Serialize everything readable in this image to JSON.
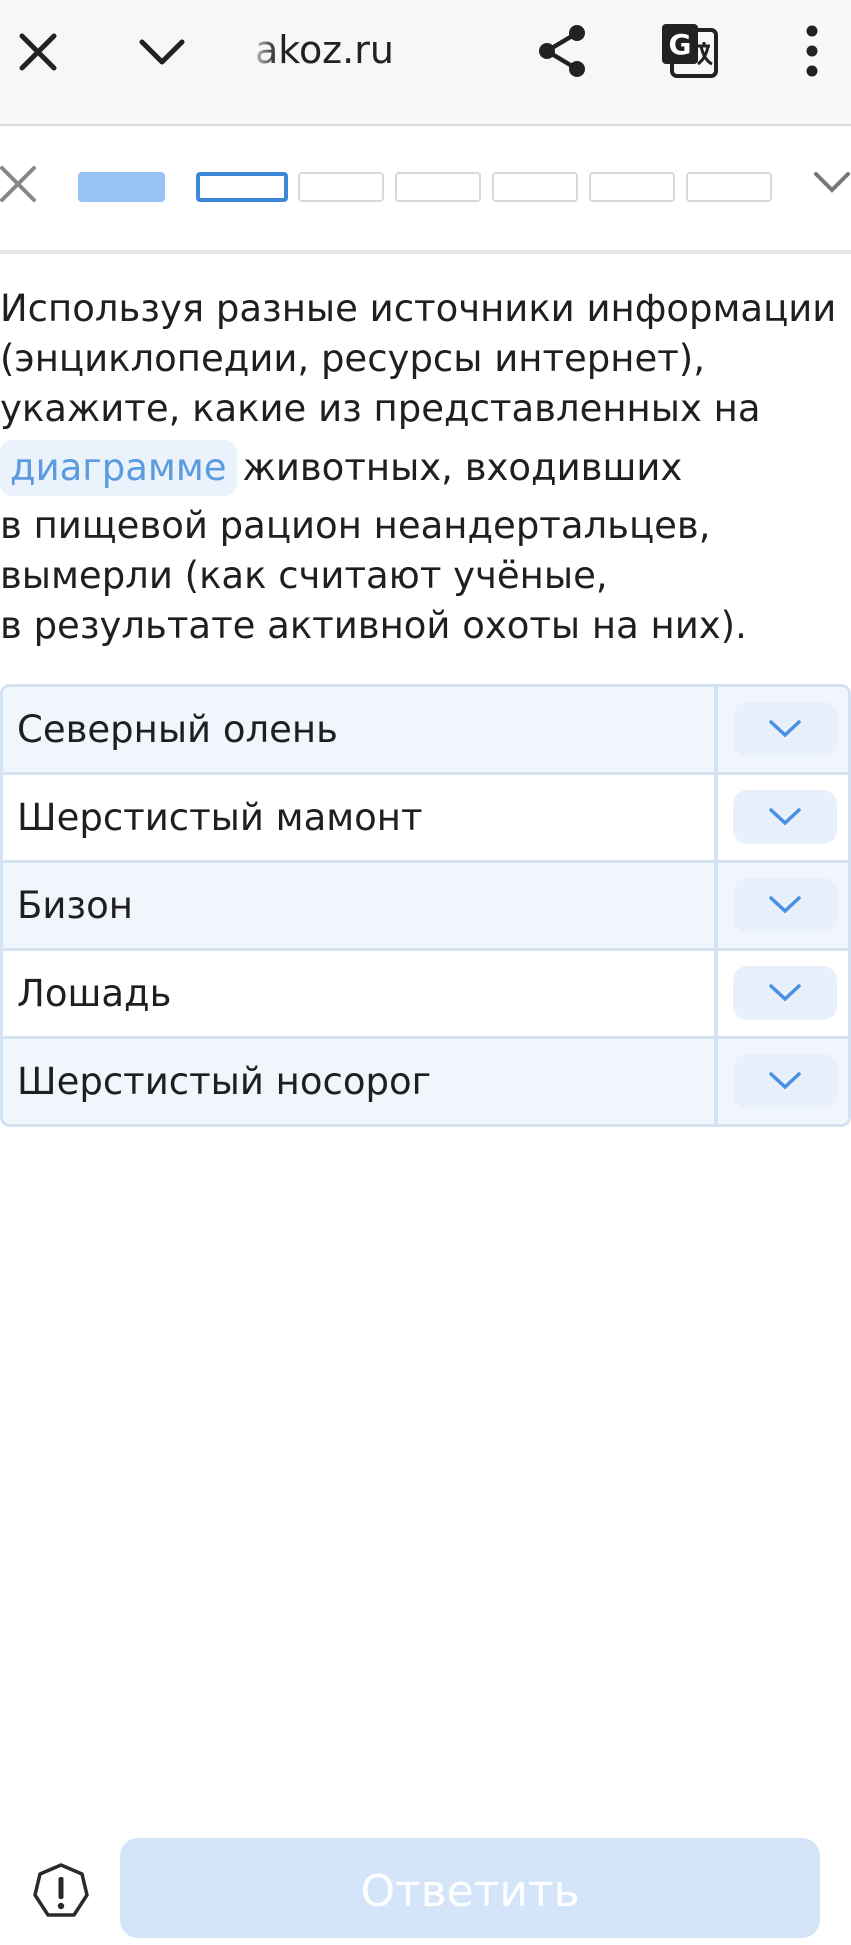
{
  "browser": {
    "url": "akoz.ru",
    "icons": [
      "close-icon",
      "chevron-down-icon",
      "share-icon",
      "translate-icon",
      "more-vertical-icon"
    ]
  },
  "progress": {
    "total_segments": 7,
    "completed": 1,
    "current": 2
  },
  "question": {
    "line1": "Используя разные источники информации",
    "line2": "(энциклопедии, ресурсы интернет),",
    "line3": "укажите, какие из представленных на",
    "link": "диаграмме",
    "line4_rest": "животных, входивших",
    "line5": "в пищевой рацион неандертальцев,",
    "line6": "вымерли (как считают учёные,",
    "line7": "в результате активной охоты на них)."
  },
  "answers": [
    {
      "label": "Северный олень"
    },
    {
      "label": "Шерстистый мамонт"
    },
    {
      "label": "Бизон"
    },
    {
      "label": "Лошадь"
    },
    {
      "label": "Шерстистый носорог"
    }
  ],
  "footer": {
    "submit_label": "Ответить",
    "report_icon": "exclamation-circle-icon"
  },
  "colors": {
    "accent": "#3d86d8",
    "progress_done": "#97c3f4",
    "chip_bg": "#eaf2fb",
    "chip_text": "#5b9be0",
    "row_alt": "#f1f6fc",
    "button_disabled": "#d4e5f9"
  }
}
